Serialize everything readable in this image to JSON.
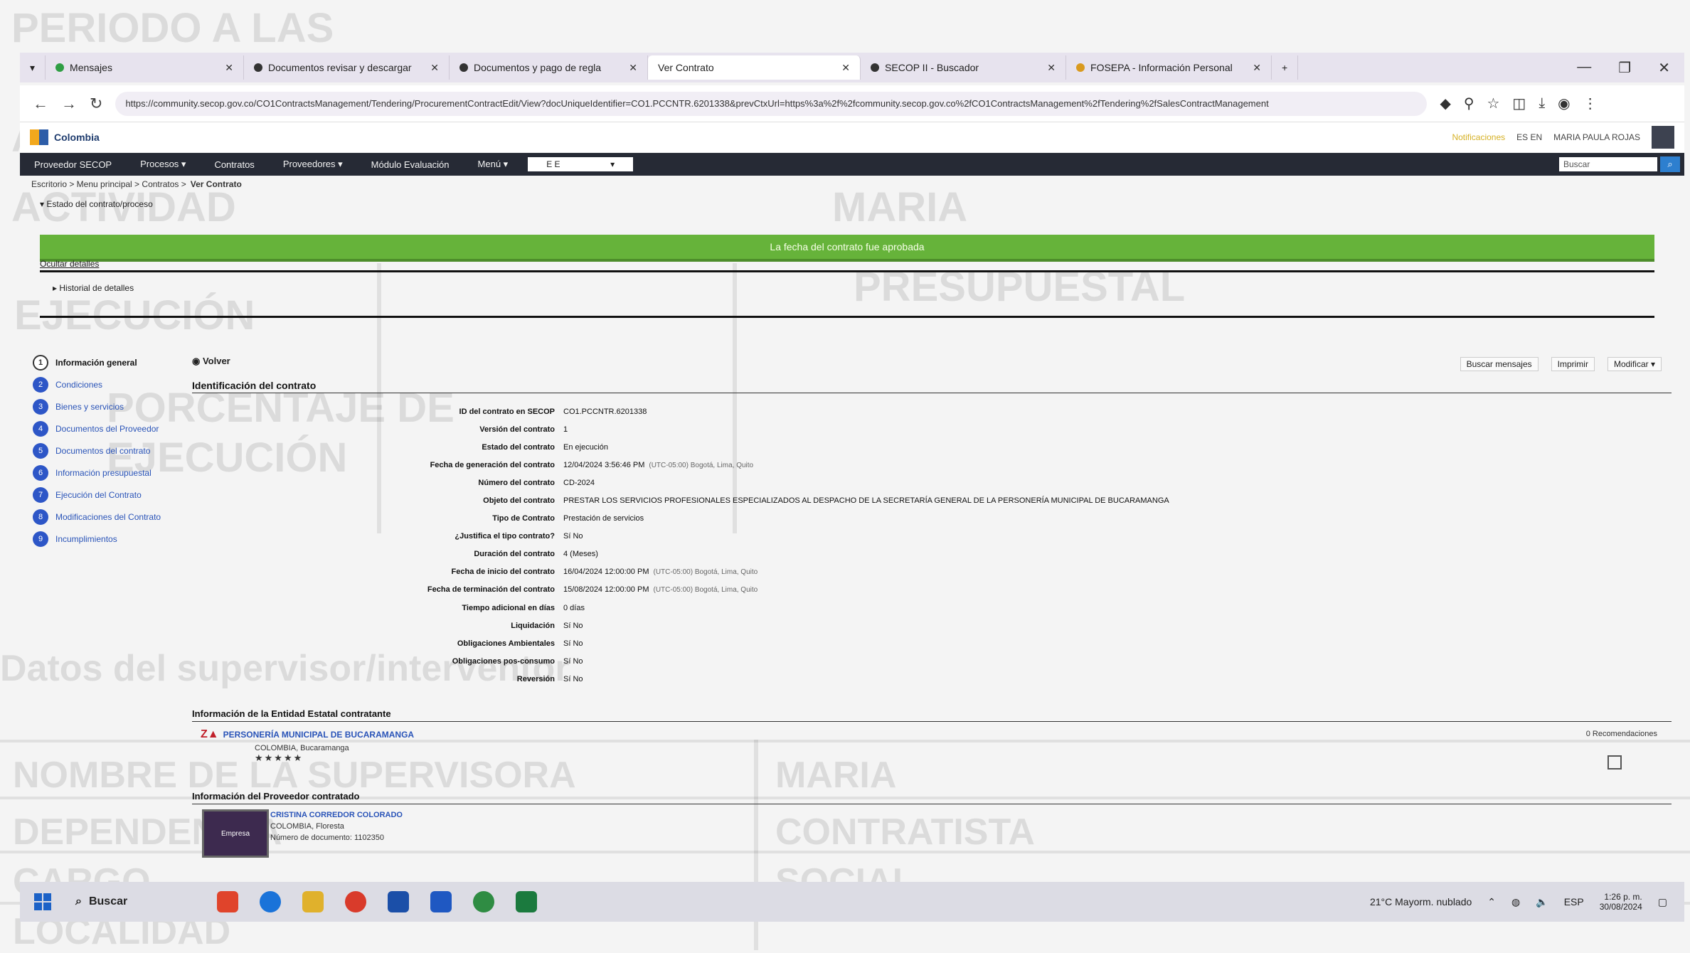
{
  "background_doc": {
    "lines": [
      "PERIODO A LAS",
      "ACTIVIDAD",
      "PORCENTAJE DE",
      "EJECUCIÓN",
      "DE EJECUCIÓN",
      "PRESUPUESTAL",
      "Datos del supervisor/interventor",
      "NOMBRE DE LA SUPERVISORA",
      "DEPENDENCIA",
      "CARGO",
      "LOCALIDAD",
      "MARIA",
      "CONTRATISTA",
      "SOCIAL"
    ]
  },
  "browser": {
    "tabs": [
      {
        "label": "Mensajes",
        "color": "#2f9e44"
      },
      {
        "label": "Documentos revisar y descargar",
        "color": "#333333"
      },
      {
        "label": "Documentos y pago de regla",
        "color": "#333333"
      },
      {
        "label": "Ver Contrato",
        "color": "#ffffff",
        "active": true
      },
      {
        "label": "SECOP II - Buscador",
        "color": "#333333"
      },
      {
        "label": "FOSEPA - Información Personal",
        "color": "#d99a1e"
      }
    ],
    "new_tab": "+",
    "url": "https://community.secop.gov.co/CO1ContractsManagement/Tendering/ProcurementContractEdit/View?docUniqueIdentifier=CO1.PCCNTR.6201338&prevCtxUrl=https%3a%2f%2fcommunity.secop.gov.co%2fCO1ContractsManagement%2fTendering%2fSalesContractManagement"
  },
  "site": {
    "logo_text": "Colombia",
    "user_link": "Notificaciones",
    "user_short": "ES EN",
    "user_name": "MARIA PAULA ROJAS",
    "menu": [
      "Proveedor SECOP",
      "Procesos ▾",
      "Contratos",
      "Proveedores ▾",
      "Módulo Evaluación",
      "Menú ▾"
    ],
    "menu_select": "E E",
    "search_placeholder": "Buscar"
  },
  "breadcrumb": {
    "path": "Escritorio > Menu principal > Contratos >",
    "current": "Ver Contrato"
  },
  "section_link": "▾  Estado del contrato/proceso",
  "alert": "La fecha del contrato fue aprobada",
  "expand_link": "Ocultar detalles",
  "sub_toggle": "▸  Historial de detalles",
  "steps": [
    {
      "num": "1",
      "label": "Información general"
    },
    {
      "num": "2",
      "label": "Condiciones"
    },
    {
      "num": "3",
      "label": "Bienes y servicios"
    },
    {
      "num": "4",
      "label": "Documentos del Proveedor"
    },
    {
      "num": "5",
      "label": "Documentos del contrato"
    },
    {
      "num": "6",
      "label": "Información presupuestal"
    },
    {
      "num": "7",
      "label": "Ejecución del Contrato"
    },
    {
      "num": "8",
      "label": "Modificaciones del Contrato"
    },
    {
      "num": "9",
      "label": "Incumplimientos"
    }
  ],
  "volver": "◉ Volver",
  "action_buttons": [
    "Buscar mensajes",
    "Imprimir",
    "Modificar ▾"
  ],
  "identification": {
    "heading": "Identificación del contrato",
    "rows": [
      {
        "label": "ID del contrato en SECOP",
        "value": "CO1.PCCNTR.6201338",
        "note": ""
      },
      {
        "label": "Versión del contrato",
        "value": "1",
        "note": ""
      },
      {
        "label": "Estado del contrato",
        "value": "En ejecución",
        "note": ""
      },
      {
        "label": "Fecha de generación del contrato",
        "value": "12/04/2024 3:56:46 PM",
        "note": "(UTC-05:00) Bogotá, Lima, Quito"
      },
      {
        "label": "Número del contrato",
        "value": "CD-2024",
        "note": ""
      },
      {
        "label": "Objeto del contrato",
        "value": "PRESTAR LOS SERVICIOS PROFESIONALES ESPECIALIZADOS AL DESPACHO DE LA SECRETARÍA GENERAL DE LA PERSONERÍA MUNICIPAL DE BUCARAMANGA",
        "note": ""
      },
      {
        "label": "Tipo de Contrato",
        "value": "Prestación de servicios",
        "note": ""
      },
      {
        "label": "¿Justifica el tipo contrato?",
        "value": "Sí  No",
        "note": ""
      },
      {
        "label": "Duración del contrato",
        "value": "4 (Meses)",
        "note": ""
      },
      {
        "label": "Fecha de inicio del contrato",
        "value": "16/04/2024 12:00:00 PM",
        "note": "(UTC-05:00) Bogotá, Lima, Quito"
      },
      {
        "label": "Fecha de terminación del contrato",
        "value": "15/08/2024 12:00:00 PM",
        "note": "(UTC-05:00) Bogotá, Lima, Quito"
      },
      {
        "label": "Tiempo adicional en días",
        "value": "0 días",
        "note": ""
      },
      {
        "label": "Liquidación",
        "value": "Sí  No",
        "note": ""
      },
      {
        "label": "Obligaciones Ambientales",
        "value": "Sí  No",
        "note": ""
      },
      {
        "label": "Obligaciones pos-consumo",
        "value": "Sí  No",
        "note": ""
      },
      {
        "label": "Reversión",
        "value": "Sí  No",
        "note": ""
      }
    ]
  },
  "entity": {
    "heading": "Información de la Entidad Estatal contratante",
    "name": "PERSONERÍA MUNICIPAL DE BUCARAMANGA",
    "city": "COLOMBIA, Bucaramanga",
    "stars": "★★★★★",
    "note": "0 Recomendaciones"
  },
  "provider": {
    "heading": "Información del Proveedor contratado",
    "badge": "Empresa",
    "name": "CRISTINA CORREDOR COLORADO",
    "country": "COLOMBIA, Floresta",
    "id_note": "Número de documento: 1102350"
  },
  "taskbar": {
    "search_label": "Buscar",
    "weather": "21°C Mayorm. nublado",
    "lang": "ESP",
    "time": "1:26 p. m.",
    "date": "30/08/2024",
    "app_colors": [
      "#e0442b",
      "#1a73d9",
      "#e0b12c",
      "#d93b2b",
      "#1b4fa8",
      "#1f58c2",
      "#2f8c43",
      "#1b7a3e"
    ]
  }
}
